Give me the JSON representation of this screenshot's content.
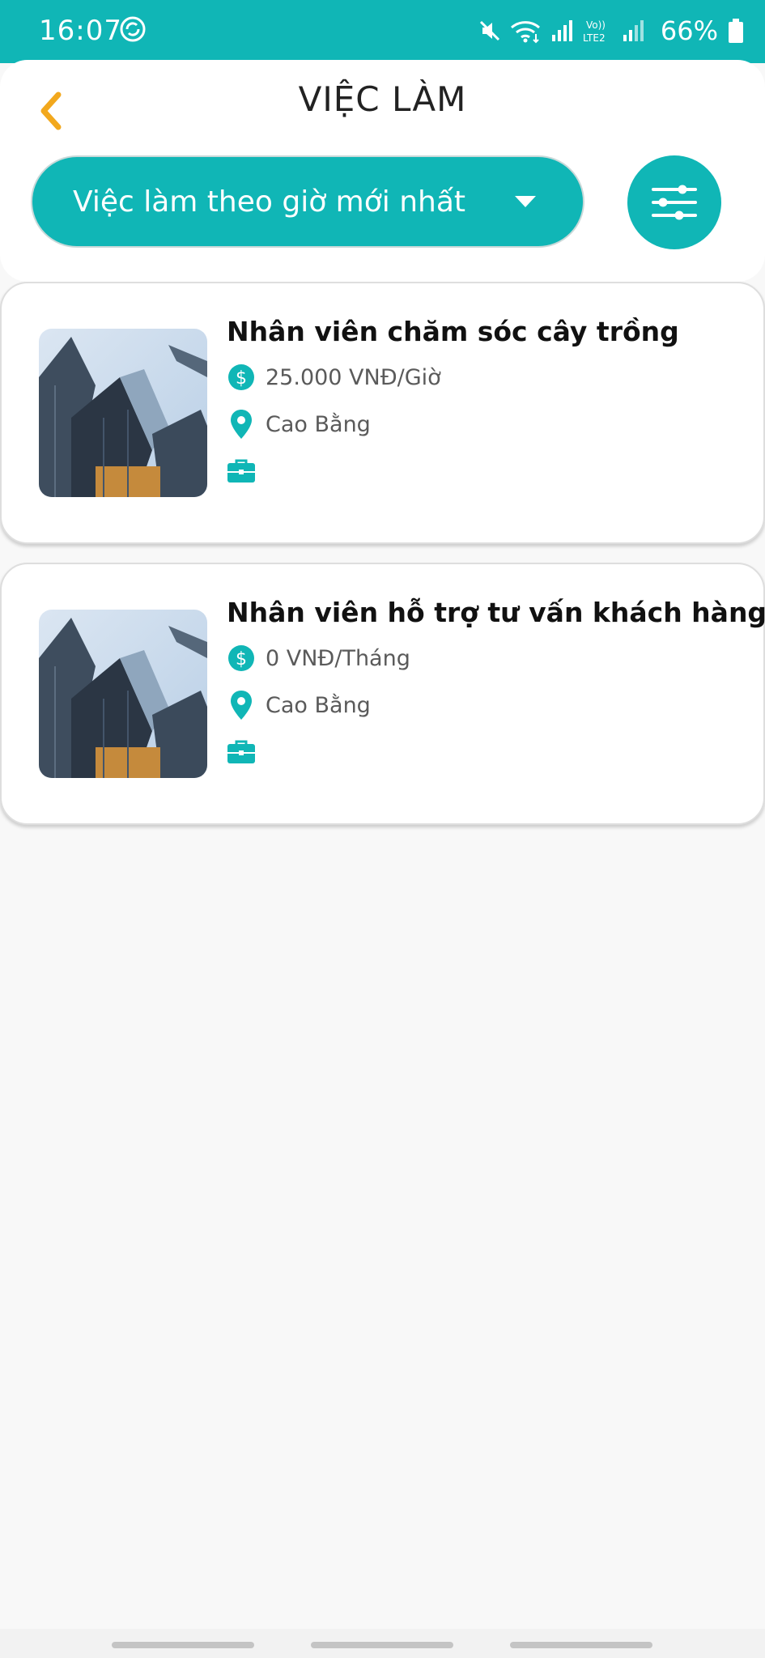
{
  "status_bar": {
    "time": "16:07",
    "battery": "66%",
    "icons": [
      "sync-icon",
      "mute-icon",
      "wifi-icon",
      "signal-icon",
      "volte-lte2-icon",
      "signal-icon",
      "battery-icon"
    ]
  },
  "header": {
    "title": "VIỆC LÀM",
    "back_icon": "chevron-left-icon",
    "sort_label": "Việc làm theo giờ mới nhất",
    "filter_icon": "sliders-icon"
  },
  "jobs": [
    {
      "title": "Nhân viên chăm sóc cây trồng",
      "salary": "25.000 VNĐ/Giờ",
      "location": "Cao Bằng",
      "type": ""
    },
    {
      "title": "Nhân viên hỗ trợ tư vấn khách hàng",
      "salary": "0 VNĐ/Tháng",
      "location": "Cao Bằng",
      "type": ""
    }
  ],
  "colors": {
    "accent": "#10b6b6",
    "back_arrow": "#f2a81d",
    "background": "#f8f8f8"
  }
}
